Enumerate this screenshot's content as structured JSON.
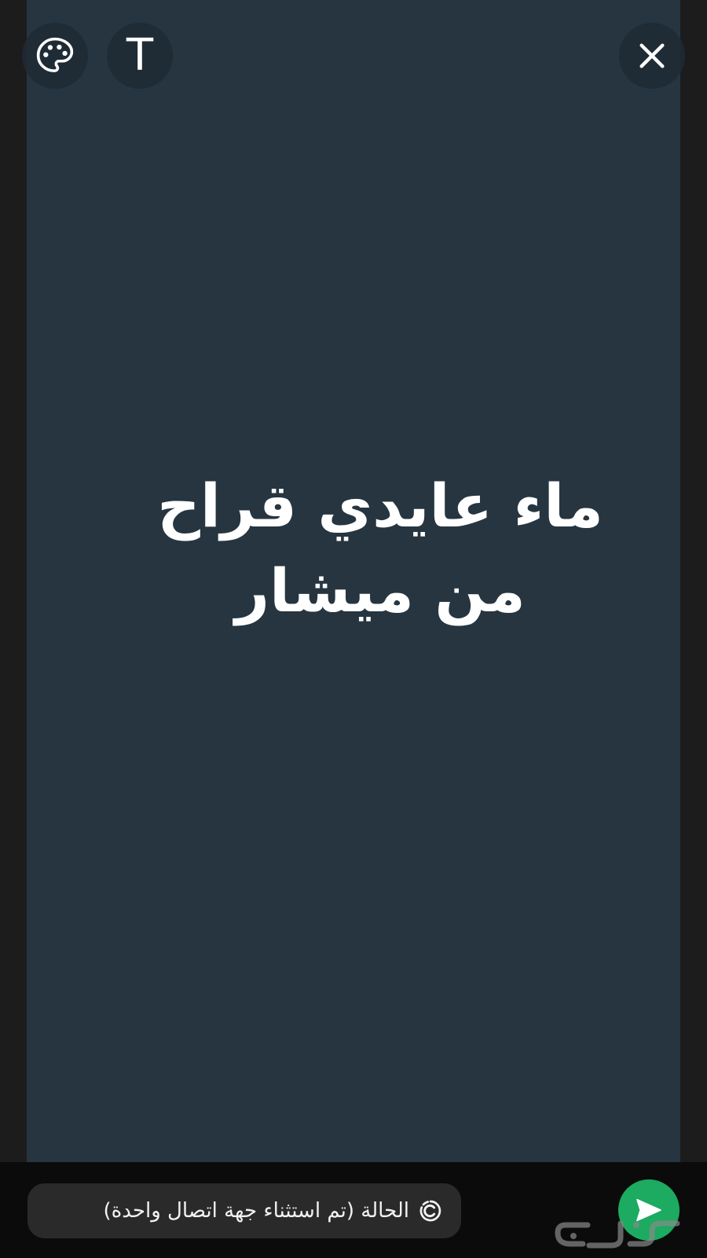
{
  "status_editor": {
    "text": "ماء عايدي قراح من ميشار",
    "background_color": "#263540",
    "text_color": "#ffffff"
  },
  "toolbar": {
    "palette_icon": "palette-icon",
    "text_tool_label": "T",
    "close_icon": "close-icon"
  },
  "footer": {
    "audience_label": "الحالة (تم استثناء جهة اتصال واحدة)",
    "audience_icon": "status-ring-icon",
    "send_icon": "send-icon",
    "send_color": "#1daa61"
  },
  "watermark": {
    "text": "حراج"
  }
}
